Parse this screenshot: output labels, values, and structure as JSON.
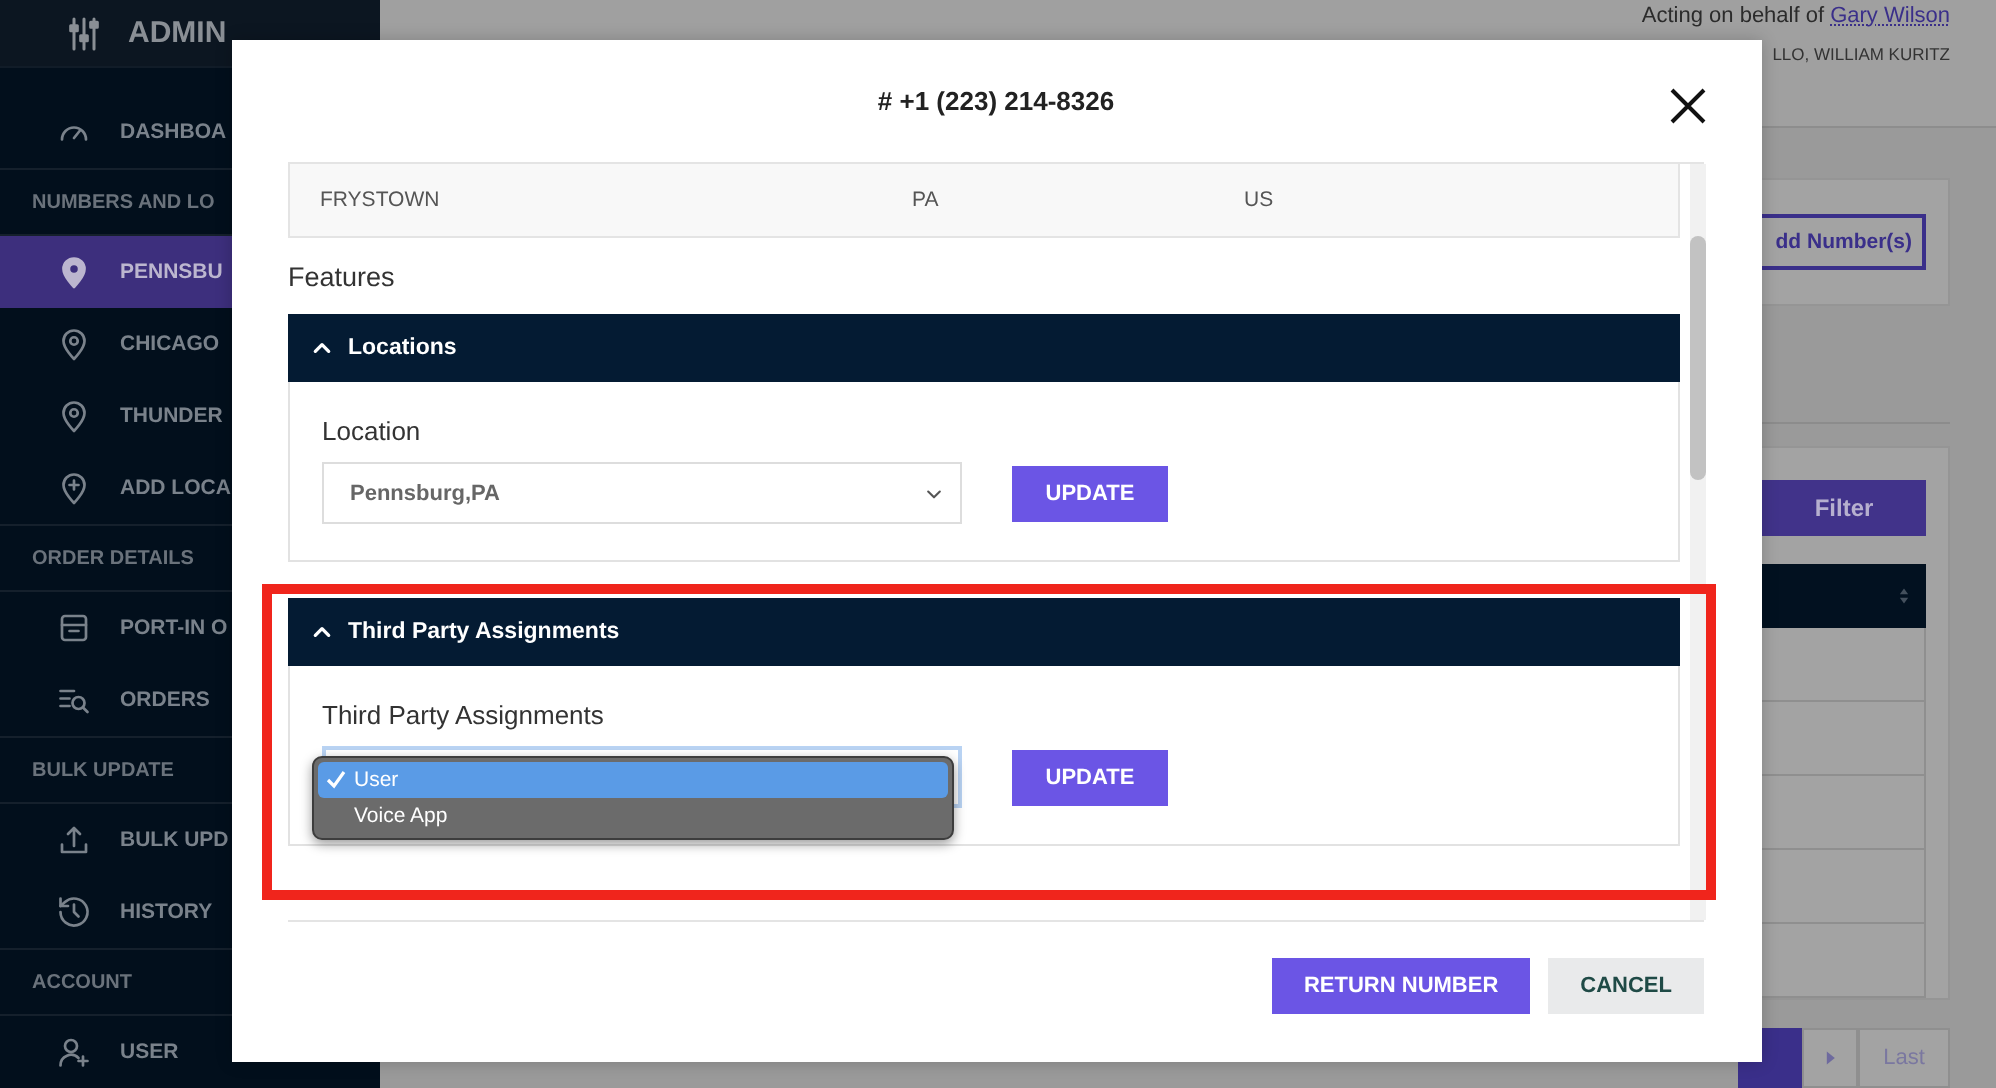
{
  "sidebar": {
    "brand": "ADMIN",
    "items": [
      {
        "kind": "item",
        "label": "DASHBOA",
        "selected": false
      },
      {
        "kind": "section",
        "label": "NUMBERS AND LO"
      },
      {
        "kind": "item",
        "label": "PENNSBU",
        "selected": true
      },
      {
        "kind": "item",
        "label": "CHICAGO",
        "selected": false
      },
      {
        "kind": "item",
        "label": "THUNDER",
        "selected": false
      },
      {
        "kind": "item",
        "label": "ADD LOCA",
        "selected": false
      },
      {
        "kind": "section",
        "label": "ORDER DETAILS"
      },
      {
        "kind": "item",
        "label": "PORT-IN O",
        "selected": false
      },
      {
        "kind": "item",
        "label": "ORDERS",
        "selected": false
      },
      {
        "kind": "section",
        "label": "BULK UPDATE"
      },
      {
        "kind": "item",
        "label": "BULK UPD",
        "selected": false
      },
      {
        "kind": "item",
        "label": "HISTORY",
        "selected": false
      },
      {
        "kind": "section",
        "label": "ACCOUNT"
      },
      {
        "kind": "item",
        "label": "USER",
        "selected": false
      }
    ]
  },
  "header": {
    "acting_prefix": "Acting on behalf of",
    "acting_user": "Gary Wilson",
    "greeting": "LLO, WILLIAM KURITZ"
  },
  "page": {
    "add_button": "dd Number(s)",
    "filter_button": "Filter",
    "pagination_last": "Last"
  },
  "modal": {
    "title": "# +1 (223) 214-8326",
    "table_row": [
      "FRYSTOWN",
      "PA",
      "US"
    ],
    "features_title": "Features",
    "sections": [
      {
        "header": "Locations",
        "expanded": true,
        "label": "Location",
        "value": "Pennsburg,PA",
        "button": "UPDATE",
        "dropdown_open": false
      },
      {
        "header": "Third Party Assignments",
        "expanded": true,
        "label": "Third Party Assignments",
        "button": "UPDATE",
        "dropdown_open": true,
        "options": [
          {
            "label": "User",
            "selected": true
          },
          {
            "label": "Voice App",
            "selected": false
          }
        ]
      }
    ],
    "buttons": [
      {
        "label": "RETURN NUMBER",
        "kind": "primary"
      },
      {
        "label": "CANCEL",
        "kind": "secondary"
      }
    ]
  }
}
